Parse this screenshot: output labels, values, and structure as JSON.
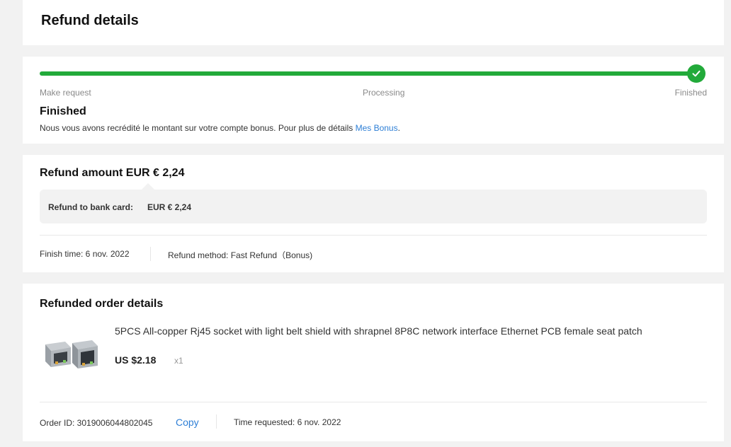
{
  "header": {
    "title": "Refund details"
  },
  "progress": {
    "steps": [
      "Make request",
      "Processing",
      "Finished"
    ],
    "completion": 1.0,
    "status_title": "Finished",
    "status_desc": "Nous vous avons recrédité le montant sur votre compte bonus. Pour plus de détails ",
    "status_link": "Mes Bonus",
    "status_end": ".",
    "accent_color": "#22aa3a",
    "link_color": "#2e7fd6"
  },
  "amount": {
    "title": "Refund amount EUR € 2,24",
    "bank_label": "Refund to bank card:",
    "bank_value": "EUR € 2,24",
    "finish_time": "Finish time: 6 nov. 2022",
    "method": "Refund method: Fast Refund（Bonus)"
  },
  "order": {
    "title": "Refunded order details",
    "product_name": "5PCS All-copper Rj45 socket with light belt shield with shrapnel 8P8C network interface Ethernet PCB female seat patch",
    "price": "US $2.18",
    "quantity": "x1",
    "order_id": "Order ID: 3019006044802045",
    "copy_label": "Copy",
    "time_requested": "Time requested: 6 nov. 2022"
  },
  "icons": {
    "finished": "check-icon",
    "product": "product-thumbnail"
  }
}
